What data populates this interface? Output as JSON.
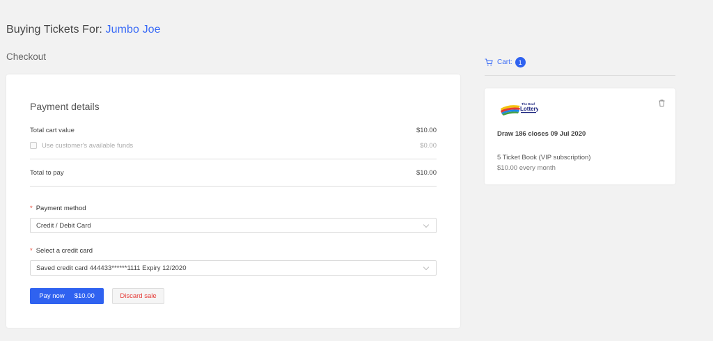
{
  "header": {
    "buying_for_label": "Buying Tickets For:",
    "customer_name": "Jumbo Joe",
    "checkout_title": "Checkout"
  },
  "payment": {
    "heading": "Payment details",
    "total_cart_label": "Total cart value",
    "total_cart_value": "$10.00",
    "funds_label": "Use customer's available funds",
    "funds_value": "$0.00",
    "total_pay_label": "Total to pay",
    "total_pay_value": "$10.00",
    "method_label": "Payment method",
    "method_value": "Credit / Debit Card",
    "card_label": "Select a credit card",
    "card_value": "Saved credit card 444433******1111 Expiry 12/2020",
    "pay_label": "Pay now",
    "pay_amount": "$10.00",
    "discard_label": "Discard sale"
  },
  "cart": {
    "label": "Cart:",
    "count": "1",
    "item": {
      "logo_text_top": "The Deaf",
      "logo_text_main": "Lottery",
      "draw_title": "Draw 186 closes 09 Jul 2020",
      "ticket_name": "5 Ticket Book (VIP subscription)",
      "ticket_price": "$10.00 every month"
    }
  },
  "colors": {
    "accent": "#2f62f0",
    "link": "#3b6cf6",
    "danger": "#e53935"
  }
}
